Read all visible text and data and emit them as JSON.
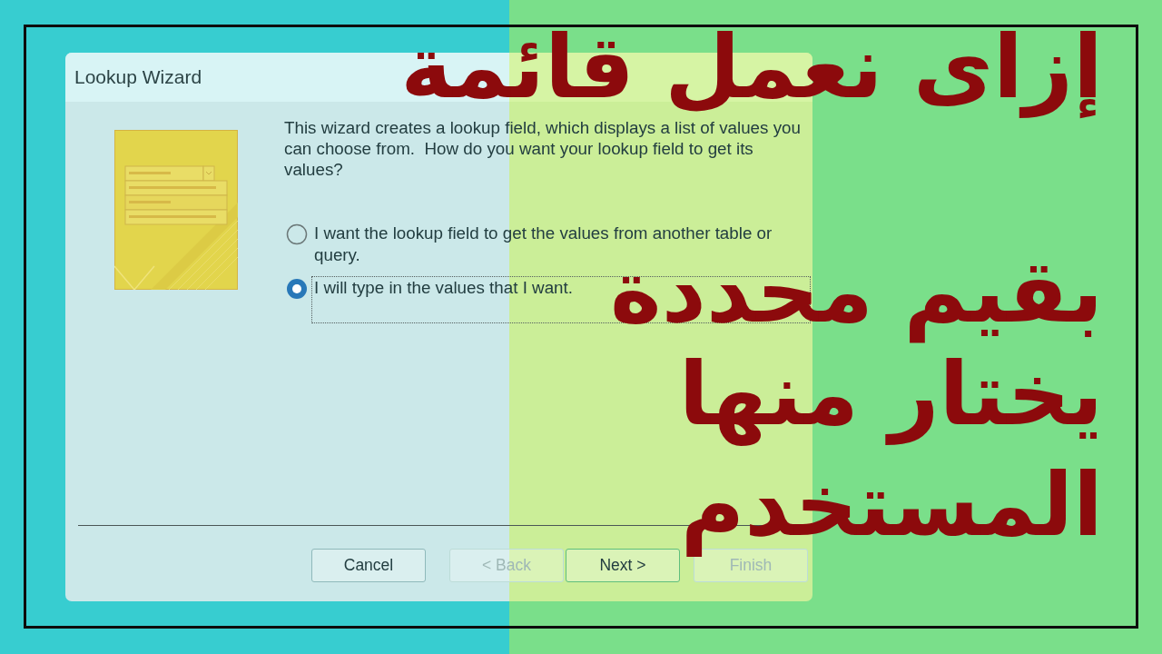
{
  "dialog": {
    "title": "Lookup Wizard",
    "description": "This wizard creates a lookup field, which displays a list of values you can choose from.  How do you want your lookup field to get its values?",
    "options": [
      {
        "label": "I want the lookup field to get the values from another table or query.",
        "selected": false,
        "focused": false
      },
      {
        "label": "I will type in the values that I want.",
        "selected": true,
        "focused": true
      }
    ],
    "buttons": [
      {
        "label": "Cancel",
        "disabled": false,
        "default": false
      },
      {
        "label": "< Back",
        "disabled": true,
        "default": false
      },
      {
        "label": "Next >",
        "disabled": false,
        "default": true
      },
      {
        "label": "Finish",
        "disabled": true,
        "default": false
      }
    ]
  },
  "headline": [
    "إزاى نعمل قائمة",
    "بقيم محددة",
    "يختار منها",
    "المستخدم"
  ]
}
